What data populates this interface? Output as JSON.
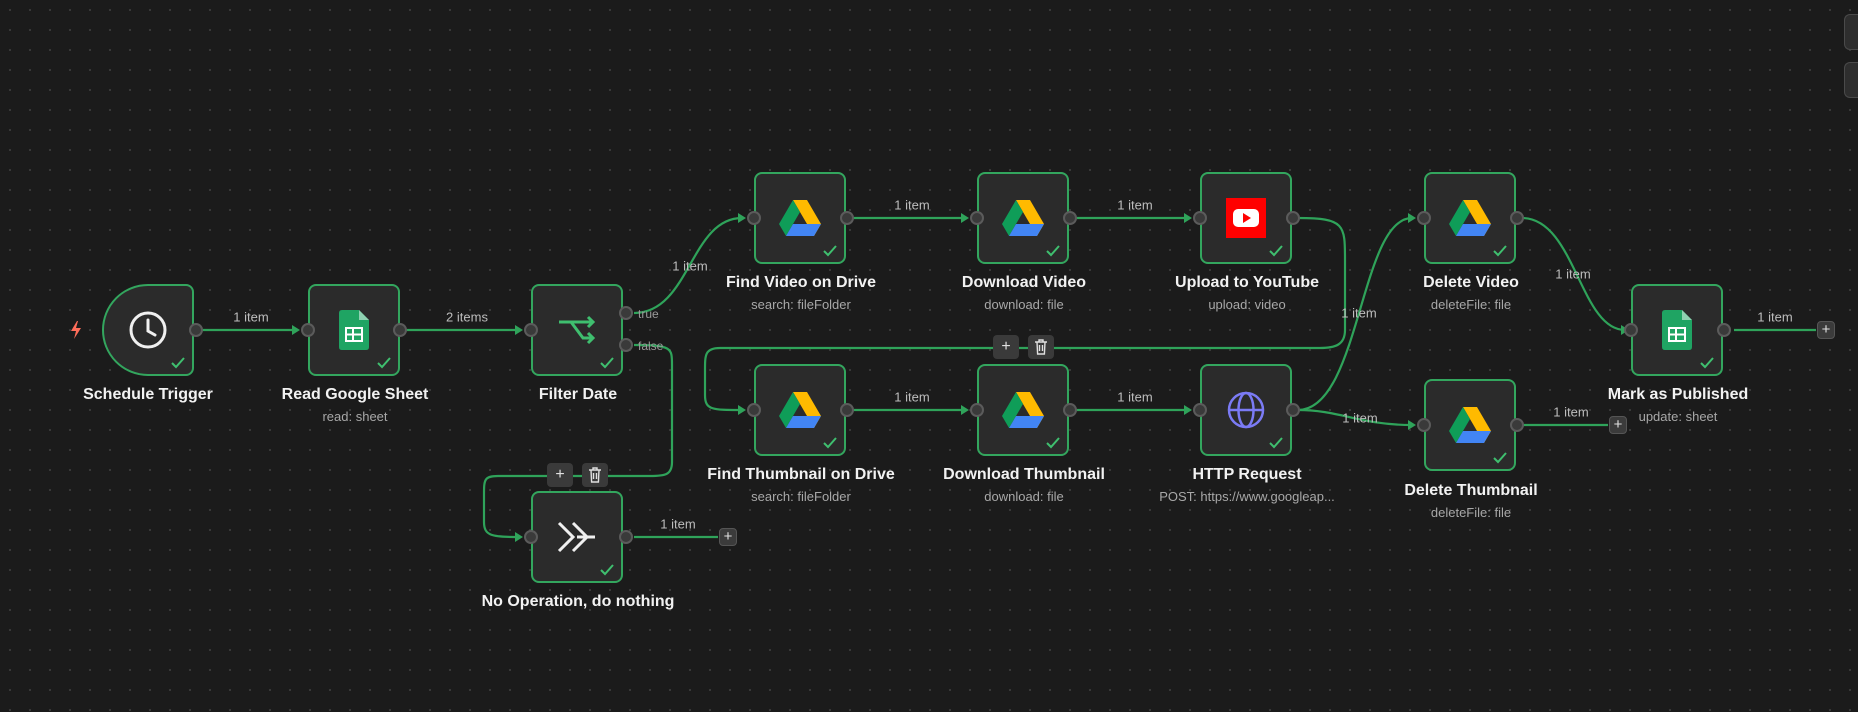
{
  "workflow": {
    "colors": {
      "canvas": "#1b1b1b",
      "node_bg": "#2b2b2b",
      "success_border": "#33a65e",
      "connection": "#2fa35a",
      "trigger_bolt": "#ff6d5a",
      "youtube_red": "#ff0000",
      "sheets_green": "#1fa463",
      "http_purple": "#7b7bf5"
    },
    "nodes": {
      "schedule_trigger": {
        "title": "Schedule Trigger",
        "subtitle": "",
        "icon": "clock-icon"
      },
      "read_sheet": {
        "title": "Read Google Sheet",
        "subtitle": "read: sheet",
        "icon": "google-sheets-icon"
      },
      "filter_date": {
        "title": "Filter Date",
        "subtitle": "",
        "icon": "filter-split-icon",
        "outputs": [
          "true",
          "false"
        ]
      },
      "find_video": {
        "title": "Find Video on Drive",
        "subtitle": "search: fileFolder",
        "icon": "google-drive-icon"
      },
      "download_video": {
        "title": "Download Video",
        "subtitle": "download: file",
        "icon": "google-drive-icon"
      },
      "upload_youtube": {
        "title": "Upload to YouTube",
        "subtitle": "upload: video",
        "icon": "youtube-icon"
      },
      "delete_video": {
        "title": "Delete Video",
        "subtitle": "deleteFile: file",
        "icon": "google-drive-icon"
      },
      "mark_published": {
        "title": "Mark as Published",
        "subtitle": "update: sheet",
        "icon": "google-sheets-icon"
      },
      "find_thumbnail": {
        "title": "Find Thumbnail on Drive",
        "subtitle": "search: fileFolder",
        "icon": "google-drive-icon"
      },
      "download_thumbnail": {
        "title": "Download Thumbnail",
        "subtitle": "download: file",
        "icon": "google-drive-icon"
      },
      "http_request": {
        "title": "HTTP Request",
        "subtitle": "POST: https://www.googleap...",
        "icon": "globe-icon"
      },
      "delete_thumbnail": {
        "title": "Delete Thumbnail",
        "subtitle": "deleteFile: file",
        "icon": "google-drive-icon"
      },
      "no_op": {
        "title": "No Operation, do nothing",
        "subtitle": "",
        "icon": "double-chevron-right-icon"
      }
    },
    "edge_labels": {
      "trigger_to_sheet": "1 item",
      "sheet_to_filter": "2 items",
      "filter_true_to_find_video": "1 item",
      "find_video_to_download_video": "1 item",
      "download_video_to_upload": "1 item",
      "upload_to_delete_video": "1 item",
      "delete_video_to_mark": "1 item",
      "mark_output": "1 item",
      "find_thumb_to_download_thumb": "1 item",
      "download_thumb_to_http": "1 item",
      "http_to_delete_thumbnail": "1 item",
      "delete_thumbnail_output": "1 item",
      "no_op_output": "1 item"
    },
    "buttons": {
      "add": "+",
      "delete_icon": "trash-icon"
    }
  }
}
